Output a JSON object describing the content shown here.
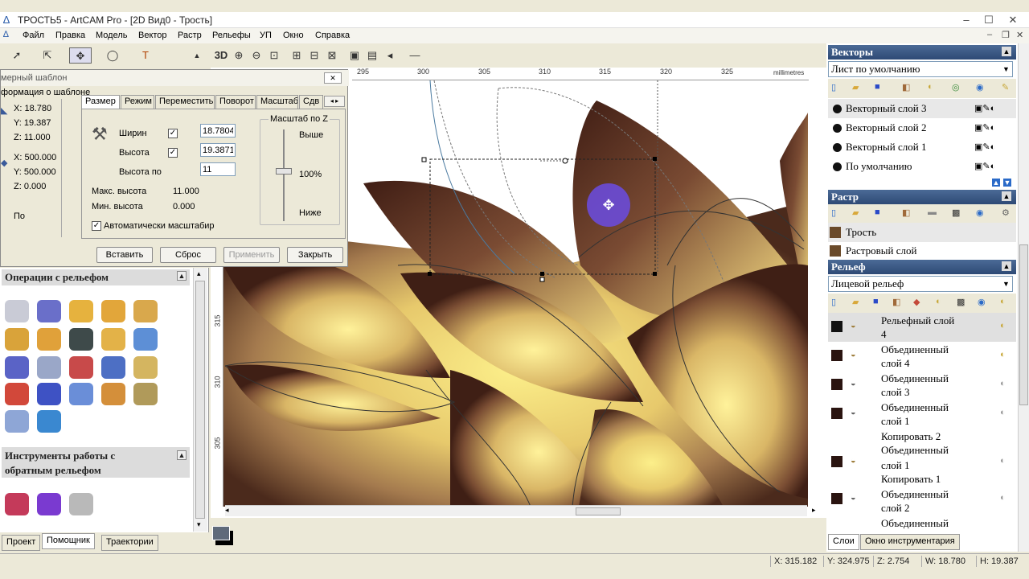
{
  "window": {
    "title": "ТРОСТЬ5 - ArtCAM Pro - [2D Вид0 - Трость]"
  },
  "menu": [
    "Файл",
    "Правка",
    "Модель",
    "Вектор",
    "Растр",
    "Рельефы",
    "УП",
    "Окно",
    "Справка"
  ],
  "view_toolbar": {
    "mode3d": "3D"
  },
  "ruler": {
    "h_labels": [
      "295",
      "300",
      "305",
      "310",
      "315",
      "320",
      "325"
    ],
    "unit": "millimetres",
    "v_labels": [
      "315",
      "310",
      "305"
    ]
  },
  "dialog": {
    "title": "мерный шаблон",
    "subtitle": "формация о шаблоне",
    "info": {
      "x1": "X:  18.780",
      "y1": "Y:  19.387",
      "z1": "Z:  11.000",
      "x2": "X:  500.000",
      "y2": "Y:  500.000",
      "z2": "Z:  0.000",
      "po": "По"
    },
    "tabs": [
      "Размер",
      "Режим",
      "Переместить",
      "Поворот",
      "Масштаб",
      "Сдв"
    ],
    "width_label": "Ширин",
    "height_label": "Высота",
    "height_po_label": "Высота по",
    "width_value": "18.7804",
    "height_value": "19.3871",
    "height_po_value": "11",
    "max_height_label": "Макс. высота",
    "max_height_value": "11.000",
    "min_height_label": "Мин. высота",
    "min_height_value": "0.000",
    "auto_scale": "Автоматически масштабир",
    "scale_z": {
      "title": "Масштаб по Z",
      "high": "Выше",
      "pct": "100%",
      "low": "Ниже"
    },
    "buttons": {
      "insert": "Вставить",
      "reset": "Сброс",
      "apply": "Применить",
      "close": "Закрыть"
    }
  },
  "left_panel": {
    "relief_ops_title": "Операции с рельефом",
    "reverse_title_1": "Инструменты работы с",
    "reverse_title_2": "обратным рельефом"
  },
  "bottom_tabs": [
    "Проект",
    "Помощник",
    "Траектории"
  ],
  "vectors_panel": {
    "title": "Векторы",
    "combo": "Лист по умолчанию",
    "layers": [
      "Векторный слой 3",
      "Векторный слой 2",
      "Векторный слой 1",
      "По умолчанию"
    ]
  },
  "raster_panel": {
    "title": "Растр",
    "items": [
      "Трость",
      "Растровый слой"
    ]
  },
  "relief_panel": {
    "title": "Рельеф",
    "combo": "Лицевой рельеф",
    "items": [
      {
        "l1": "Рельефный слой",
        "l2": "4"
      },
      {
        "l1": "Объединенный",
        "l2": "слой 4"
      },
      {
        "l1": "Объединенный",
        "l2": "слой 3"
      },
      {
        "l1": "Объединенный",
        "l2": "слой 1"
      },
      {
        "l1": "Копировать 2",
        "l2": "Объединенный"
      },
      {
        "l1": "слой 1",
        "l2": "Копировать 1"
      },
      {
        "l1": "Объединенный",
        "l2": "слой 2"
      },
      {
        "l1": "Объединенный",
        "l2": ""
      }
    ]
  },
  "right_tabs": [
    "Слои",
    "Окно инструментария"
  ],
  "status": {
    "x": "X: 315.182",
    "y": "Y: 324.975",
    "z": "Z: 2.754",
    "w": "W: 18.780",
    "h": "H: 19.387"
  }
}
